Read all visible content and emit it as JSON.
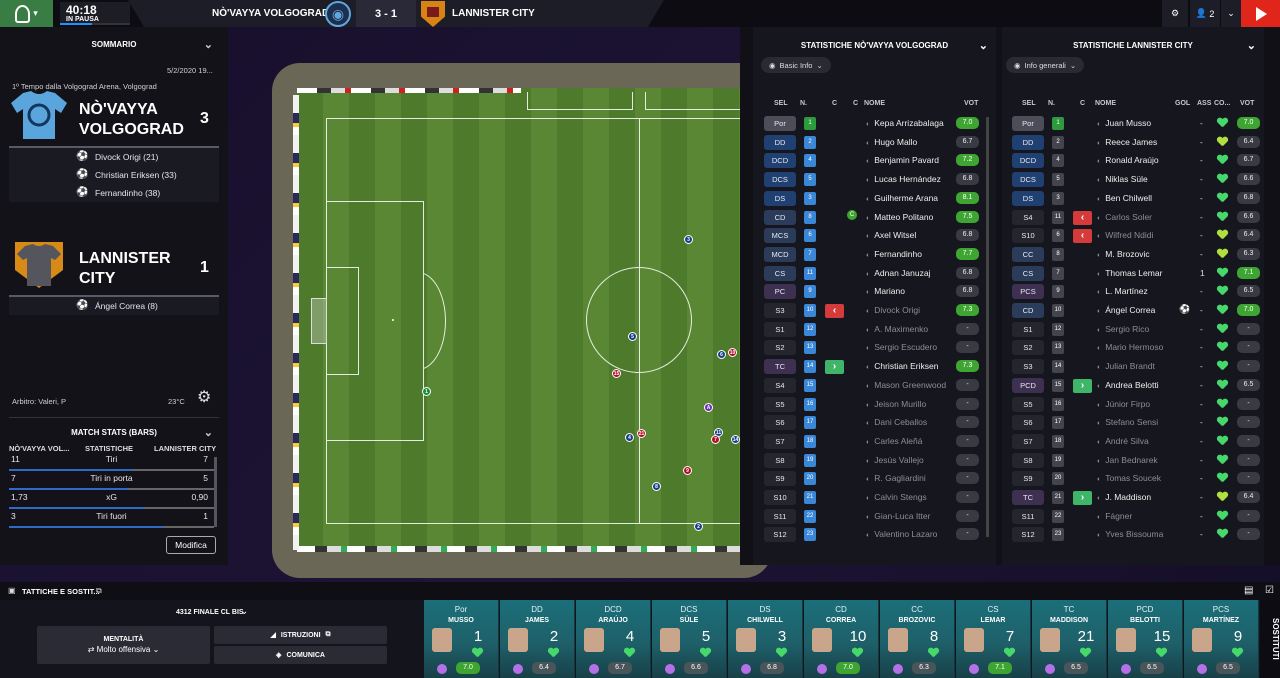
{
  "topbar": {
    "time": "40:18",
    "status": "IN PAUSA",
    "home_team": "NÒ'VAYYA VOLGOGRAD",
    "score": "3 - 1",
    "away_team": "LANNISTER CITY",
    "users": "2"
  },
  "summary": {
    "title": "SOMMARIO",
    "date": "5/2/2020 19...",
    "venue": "1º Tempo dalla Volgograd Arena, Volgograd",
    "home_name": "NÒ'VAYYA VOLGOGRAD",
    "home_line1": "NÒ'VAYYA",
    "home_line2": "VOLGOGRAD",
    "home_score": "3",
    "home_scorers": [
      "Divock Origi (21)",
      "Christian Eriksen (33)",
      "Fernandinho (38)"
    ],
    "away_line1": "LANNISTER",
    "away_line2": "CITY",
    "away_score": "1",
    "away_scorers": [
      "Ángel Correa (8)"
    ],
    "referee": "Arbitro: Valeri, P",
    "temperature": "23°C"
  },
  "match_stats": {
    "title": "MATCH STATS (BARS)",
    "col_home": "NÒ'VAYYA VOL...",
    "col_mid": "STATISTICHE",
    "col_away": "LANNISTER CITY",
    "rows": [
      {
        "home": "11",
        "label": "Tiri",
        "away": "7"
      },
      {
        "home": "7",
        "label": "Tiri in porta",
        "away": "5"
      },
      {
        "home": "1,73",
        "label": "xG",
        "away": "0,90"
      },
      {
        "home": "3",
        "label": "Tiri fuori",
        "away": "1"
      }
    ],
    "edit_label": "Modifica"
  },
  "home_stats": {
    "title": "STATISTICHE NÒ'VAYYA VOLGOGRAD",
    "view": "Basic Info",
    "columns": [
      "SEL",
      "N.",
      "C",
      "C",
      "NOME",
      "VOT"
    ],
    "players": [
      {
        "pos": "Por",
        "num": "1",
        "name": "Kepa Arrizabalaga",
        "rating": "7.0",
        "sub": "",
        "dim": false
      },
      {
        "pos": "DD",
        "num": "2",
        "name": "Hugo Mallo",
        "rating": "6.7",
        "sub": "",
        "dim": false
      },
      {
        "pos": "DCD",
        "num": "4",
        "name": "Benjamin Pavard",
        "rating": "7.2",
        "sub": "",
        "dim": false
      },
      {
        "pos": "DCS",
        "num": "5",
        "name": "Lucas Hernández",
        "rating": "6.8",
        "sub": "",
        "dim": false
      },
      {
        "pos": "DS",
        "num": "3",
        "name": "Guilherme Arana",
        "rating": "8.1",
        "sub": "",
        "dim": false
      },
      {
        "pos": "CD",
        "num": "8",
        "name": "Matteo Politano",
        "rating": "7.5",
        "sub": "",
        "dim": false
      },
      {
        "pos": "MCS",
        "num": "6",
        "name": "Axel Witsel",
        "rating": "6.8",
        "sub": "",
        "dim": false
      },
      {
        "pos": "MCD",
        "num": "7",
        "name": "Fernandinho",
        "rating": "7.7",
        "sub": "",
        "dim": false
      },
      {
        "pos": "CS",
        "num": "11",
        "name": "Adnan Januzaj",
        "rating": "6.8",
        "sub": "",
        "dim": false
      },
      {
        "pos": "PC",
        "num": "9",
        "name": "Mariano",
        "rating": "6.8",
        "sub": "",
        "dim": false
      },
      {
        "pos": "S3",
        "num": "10",
        "name": "Divock Origi",
        "rating": "7.3",
        "sub": "out",
        "dim": true
      },
      {
        "pos": "S1",
        "num": "12",
        "name": "A. Maximenko",
        "rating": "-",
        "sub": "",
        "dim": true
      },
      {
        "pos": "S2",
        "num": "13",
        "name": "Sergio Escudero",
        "rating": "-",
        "sub": "",
        "dim": true
      },
      {
        "pos": "TC",
        "num": "14",
        "name": "Christian Eriksen",
        "rating": "7.3",
        "sub": "in",
        "dim": false
      },
      {
        "pos": "S4",
        "num": "15",
        "name": "Mason Greenwood",
        "rating": "-",
        "sub": "",
        "dim": true
      },
      {
        "pos": "S5",
        "num": "16",
        "name": "Jeison Murillo",
        "rating": "-",
        "sub": "",
        "dim": true
      },
      {
        "pos": "S6",
        "num": "17",
        "name": "Dani Ceballos",
        "rating": "-",
        "sub": "",
        "dim": true
      },
      {
        "pos": "S7",
        "num": "18",
        "name": "Carles Aleñá",
        "rating": "-",
        "sub": "",
        "dim": true
      },
      {
        "pos": "S8",
        "num": "19",
        "name": "Jesús Vallejo",
        "rating": "-",
        "sub": "",
        "dim": true
      },
      {
        "pos": "S9",
        "num": "20",
        "name": "R. Gagliardini",
        "rating": "-",
        "sub": "",
        "dim": true
      },
      {
        "pos": "S10",
        "num": "21",
        "name": "Calvin Stengs",
        "rating": "-",
        "sub": "",
        "dim": true
      },
      {
        "pos": "S11",
        "num": "22",
        "name": "Gian-Luca Itter",
        "rating": "-",
        "sub": "",
        "dim": true
      },
      {
        "pos": "S12",
        "num": "23",
        "name": "Valentino Lazaro",
        "rating": "-",
        "sub": "",
        "dim": true
      }
    ]
  },
  "away_stats": {
    "title": "STATISTICHE LANNISTER CITY",
    "view": "Info generali",
    "columns": [
      "SEL",
      "N.",
      "C",
      "NOME",
      "GOL",
      "ASS",
      "CO...",
      "VOT"
    ],
    "players": [
      {
        "pos": "Por",
        "num": "1",
        "name": "Juan Musso",
        "gol": "-",
        "rating": "7.0",
        "sub": "",
        "dim": false
      },
      {
        "pos": "DD",
        "num": "2",
        "name": "Reece James",
        "gol": "-",
        "rating": "6.4",
        "sub": "",
        "dim": false
      },
      {
        "pos": "DCD",
        "num": "4",
        "name": "Ronald Araújo",
        "gol": "-",
        "rating": "6.7",
        "sub": "",
        "dim": false
      },
      {
        "pos": "DCS",
        "num": "5",
        "name": "Niklas Süle",
        "gol": "-",
        "rating": "6.6",
        "sub": "",
        "dim": false
      },
      {
        "pos": "DS",
        "num": "3",
        "name": "Ben Chilwell",
        "gol": "-",
        "rating": "6.8",
        "sub": "",
        "dim": false
      },
      {
        "pos": "S4",
        "num": "11",
        "name": "Carlos Soler",
        "gol": "-",
        "rating": "6.6",
        "sub": "out",
        "dim": true
      },
      {
        "pos": "S10",
        "num": "6",
        "name": "Wilfred Ndidi",
        "gol": "-",
        "rating": "6.4",
        "sub": "out",
        "dim": true
      },
      {
        "pos": "CC",
        "num": "8",
        "name": "M. Brozovic",
        "gol": "-",
        "rating": "6.3",
        "sub": "",
        "dim": false
      },
      {
        "pos": "CS",
        "num": "7",
        "name": "Thomas Lemar",
        "gol": "1",
        "rating": "7.1",
        "sub": "",
        "dim": false
      },
      {
        "pos": "PCS",
        "num": "9",
        "name": "L. Martínez",
        "gol": "-",
        "rating": "6.5",
        "sub": "",
        "dim": false
      },
      {
        "pos": "CD",
        "num": "10",
        "name": "Ángel Correa",
        "gol": "-",
        "rating": "7.0",
        "sub": "",
        "dim": false
      },
      {
        "pos": "S1",
        "num": "12",
        "name": "Sergio Rico",
        "gol": "-",
        "rating": "-",
        "sub": "",
        "dim": true
      },
      {
        "pos": "S2",
        "num": "13",
        "name": "Mario Hermoso",
        "gol": "-",
        "rating": "-",
        "sub": "",
        "dim": true
      },
      {
        "pos": "S3",
        "num": "14",
        "name": "Julian Brandt",
        "gol": "-",
        "rating": "-",
        "sub": "",
        "dim": true
      },
      {
        "pos": "PCD",
        "num": "15",
        "name": "Andrea Belotti",
        "gol": "-",
        "rating": "6.5",
        "sub": "in",
        "dim": false
      },
      {
        "pos": "S5",
        "num": "16",
        "name": "Júnior Firpo",
        "gol": "-",
        "rating": "-",
        "sub": "",
        "dim": true
      },
      {
        "pos": "S6",
        "num": "17",
        "name": "Stefano Sensi",
        "gol": "-",
        "rating": "-",
        "sub": "",
        "dim": true
      },
      {
        "pos": "S7",
        "num": "18",
        "name": "André Silva",
        "gol": "-",
        "rating": "-",
        "sub": "",
        "dim": true
      },
      {
        "pos": "S8",
        "num": "19",
        "name": "Jan Bednarek",
        "gol": "-",
        "rating": "-",
        "sub": "",
        "dim": true
      },
      {
        "pos": "S9",
        "num": "20",
        "name": "Tomas Soucek",
        "gol": "-",
        "rating": "-",
        "sub": "",
        "dim": true
      },
      {
        "pos": "TC",
        "num": "21",
        "name": "J. Maddison",
        "gol": "-",
        "rating": "6.4",
        "sub": "in",
        "dim": false
      },
      {
        "pos": "S11",
        "num": "22",
        "name": "Fágner",
        "gol": "-",
        "rating": "-",
        "sub": "",
        "dim": true
      },
      {
        "pos": "S12",
        "num": "23",
        "name": "Yves Bissouma",
        "gol": "-",
        "rating": "-",
        "sub": "",
        "dim": true
      }
    ]
  },
  "bottom": {
    "tactics_label": "TATTICHE E SOSTIT...",
    "formation": "4312 FINALE CL BIS",
    "mentality_label": "MENTALITÀ",
    "mentality_value": "Molto offensiva",
    "instructions": "ISTRUZIONI",
    "communicate": "COMUNICA",
    "subs_label": "SOSTITUTI",
    "cards": [
      {
        "pos": "Por",
        "name": "MUSSO",
        "num": "1",
        "rating": "7.0"
      },
      {
        "pos": "DD",
        "name": "JAMES",
        "num": "2",
        "rating": "6.4"
      },
      {
        "pos": "DCD",
        "name": "ARAÚJO",
        "num": "4",
        "rating": "6.7"
      },
      {
        "pos": "DCS",
        "name": "SÜLE",
        "num": "5",
        "rating": "6.6"
      },
      {
        "pos": "DS",
        "name": "CHILWELL",
        "num": "3",
        "rating": "6.8"
      },
      {
        "pos": "CD",
        "name": "CORREA",
        "num": "10",
        "rating": "7.0"
      },
      {
        "pos": "CC",
        "name": "BROZOVIC",
        "num": "8",
        "rating": "6.3"
      },
      {
        "pos": "CS",
        "name": "LEMAR",
        "num": "7",
        "rating": "7.1"
      },
      {
        "pos": "TC",
        "name": "MADDISON",
        "num": "21",
        "rating": "6.5"
      },
      {
        "pos": "PCD",
        "name": "BELOTTI",
        "num": "15",
        "rating": "6.5"
      },
      {
        "pos": "PCS",
        "name": "MARTÍNEZ",
        "num": "9",
        "rating": "6.5"
      }
    ]
  },
  "pitch": {
    "players": [
      {
        "n": "1",
        "team": "gk"
      },
      {
        "n": "3",
        "team": "home"
      },
      {
        "n": "5",
        "team": "home"
      },
      {
        "n": "6",
        "team": "home"
      },
      {
        "n": "10",
        "team": "away"
      },
      {
        "n": "15",
        "team": "away"
      },
      {
        "n": "A",
        "team": "ref"
      },
      {
        "n": "11",
        "team": "home"
      },
      {
        "n": "14",
        "team": "home"
      },
      {
        "n": "7",
        "team": "away"
      },
      {
        "n": "21",
        "team": "away"
      },
      {
        "n": "4",
        "team": "home"
      },
      {
        "n": "9",
        "team": "away"
      },
      {
        "n": "8",
        "team": "home"
      },
      {
        "n": "2",
        "team": "home"
      }
    ]
  }
}
